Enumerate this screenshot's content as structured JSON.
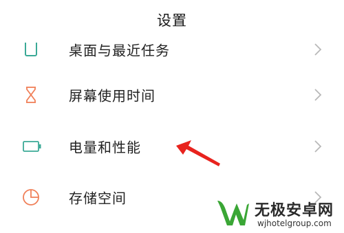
{
  "header": {
    "title": "设置"
  },
  "items": [
    {
      "label": "桌面与最近任务",
      "icon": "home-screen-icon",
      "clipped": true
    },
    {
      "label": "屏幕使用时间",
      "icon": "hourglass-icon"
    },
    {
      "label": "电量和性能",
      "icon": "battery-icon"
    },
    {
      "label": "存储空间",
      "icon": "storage-pie-icon"
    }
  ],
  "annotation": {
    "icon": "red-arrow-pointer",
    "color": "#e8231e"
  },
  "watermark": {
    "title": "无极安卓网",
    "url": "wjhotelgroup.com",
    "logo_color": "#3aa635"
  },
  "colors": {
    "icon_accent": "#3aa996",
    "chevron": "#b8b8b8",
    "storage_icon": "#f07f58"
  }
}
